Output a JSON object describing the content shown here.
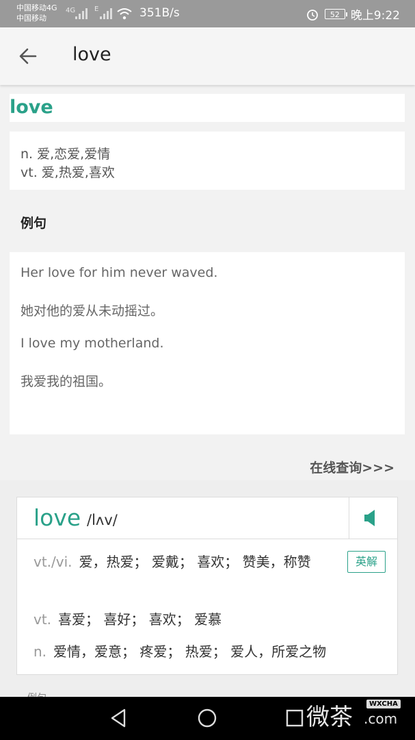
{
  "status_bar": {
    "carrier1": "中国移动4G",
    "carrier2": "中国移动",
    "net1": "4G",
    "net2": "E",
    "speed": "351B/s",
    "battery": "52",
    "time": "晚上9:22"
  },
  "app_bar": {
    "title": "love"
  },
  "word": {
    "headword": "love",
    "definitions": [
      "n. 爱,恋爱,爱情",
      "vt. 爱,热爱,喜欢"
    ]
  },
  "examples_section": {
    "title": "例句",
    "items": [
      "Her love for him never waved.",
      "她对他的爱从未动摇过。",
      "I love my motherland.",
      "我爱我的祖国。"
    ]
  },
  "online_link": "在线查询>>>",
  "dictionary": {
    "word": "love",
    "phonetic": "/lʌv/",
    "english_button": "英解",
    "rows": [
      {
        "pos": "vt./vi.",
        "meaning": "爱，热爱； 爱戴； 喜欢； 赞美，称赞"
      },
      {
        "pos": "vt.",
        "meaning": "喜爱； 喜好； 喜欢； 爱慕"
      },
      {
        "pos": "n.",
        "meaning": "爱情，爱意； 疼爱； 热爱； 爱人，所爱之物"
      }
    ],
    "peek_text": "例句"
  },
  "watermark": {
    "text": "微茶",
    "badge": "WXCHA",
    "domain": ".com"
  },
  "colors": {
    "accent": "#2aa189",
    "status_bar": "#9a9a9a",
    "nav_bar": "#000000"
  },
  "icons": [
    "back-arrow-icon",
    "speaker-icon",
    "nav-back-icon",
    "nav-home-icon",
    "nav-recents-icon",
    "alarm-icon",
    "wifi-icon",
    "signal-icon"
  ]
}
